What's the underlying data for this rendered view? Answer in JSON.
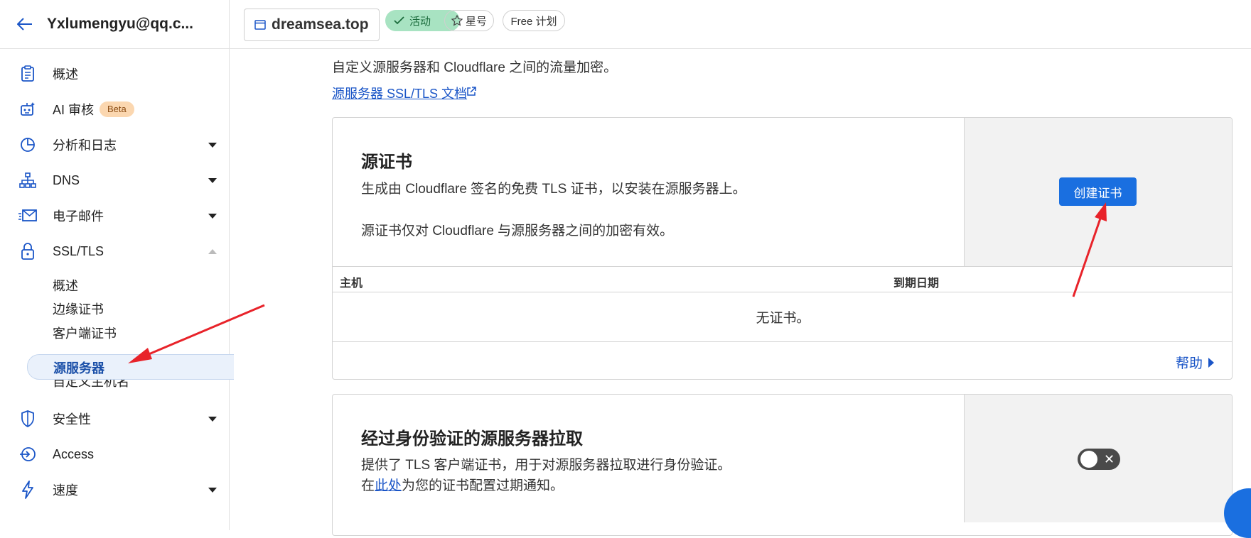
{
  "account": {
    "name": "Yxlumengyu@qq.c..."
  },
  "sidebar": {
    "items": [
      {
        "label": "概述",
        "icon": "clipboard-icon"
      },
      {
        "label": "AI 审核",
        "badge": "Beta",
        "icon": "robot-icon"
      },
      {
        "label": "分析和日志",
        "icon": "pie-chart-icon"
      },
      {
        "label": "DNS",
        "icon": "network-icon"
      },
      {
        "label": "电子邮件",
        "icon": "email-icon"
      },
      {
        "label": "SSL/TLS",
        "icon": "lock-icon"
      },
      {
        "label": "安全性",
        "icon": "shield-icon"
      },
      {
        "label": "Access",
        "icon": "access-icon"
      },
      {
        "label": "速度",
        "icon": "bolt-icon"
      }
    ],
    "ssl_subitems": [
      "概述",
      "边缘证书",
      "客户端证书",
      "源服务器",
      "自定义主机名"
    ],
    "active_subitem": "源服务器"
  },
  "topbar": {
    "domain": "dreamsea.top",
    "status": "活动",
    "star": "星号",
    "plan": "Free 计划"
  },
  "main": {
    "intro": "自定义源服务器和 Cloudflare 之间的流量加密。",
    "doc_link": "源服务器 SSL/TLS 文档",
    "origin_cert": {
      "title": "源证书",
      "desc1": "生成由 Cloudflare 签名的免费 TLS 证书，以安装在源服务器上。",
      "desc2": "源证书仅对 Cloudflare 与源服务器之间的加密有效。",
      "button": "创建证书",
      "columns": [
        "主机",
        "到期日期"
      ],
      "empty": "无证书。",
      "help": "帮助"
    },
    "aop": {
      "title": "经过身份验证的源服务器拉取",
      "desc1": "提供了 TLS 客户端证书，用于对源服务器拉取进行身份验证。",
      "desc2_prefix": "在",
      "desc2_link": "此处",
      "desc2_suffix": "为您的证书配置过期通知。",
      "toggle_on": false
    }
  },
  "colors": {
    "accent": "#1a6fe0",
    "link": "#1a55c7",
    "active_pill": "#a8e3c2",
    "beta_badge": "#fbd7b0",
    "annotation_arrow": "#e8232a"
  }
}
